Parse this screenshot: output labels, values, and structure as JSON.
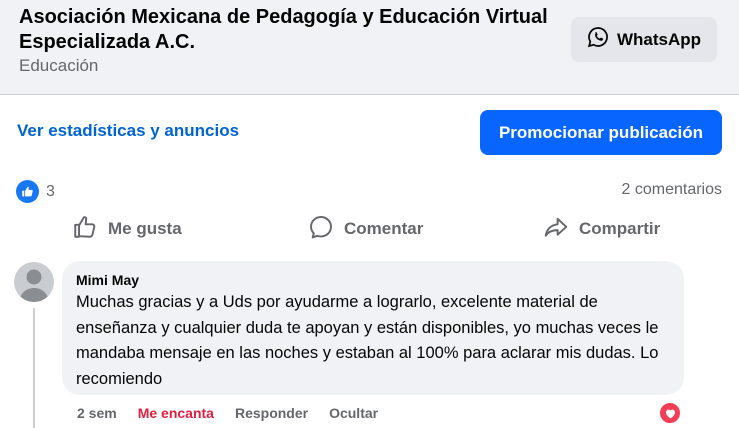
{
  "header": {
    "page_name": "Asociación Mexicana de Pedagogía y Educación Virtual Especializada A.C.",
    "category": "Educación",
    "whatsapp_label": "WhatsApp"
  },
  "promo": {
    "stats_link": "Ver estadísticas y anuncios",
    "promote_button": "Promocionar publicación"
  },
  "post_stats": {
    "like_count": "3",
    "comments_label": "2 comentarios"
  },
  "actions": {
    "like": "Me gusta",
    "comment": "Comentar",
    "share": "Compartir"
  },
  "comment": {
    "author": "Mimi May",
    "text": "Muchas gracias y a Uds por ayudarme a lograrlo, excelente material de enseñanza y cualquier duda te apoyan y están disponibles, yo muchas veces le mandaba mensaje en las noches y estaban al 100% para aclarar mis dudas. Lo recomiendo",
    "time": "2 sem",
    "reaction_label": "Me encanta",
    "reply_label": "Responder",
    "hide_label": "Ocultar"
  },
  "colors": {
    "primary": "#0866ff",
    "link": "#0064d1",
    "love": "#e41e3f",
    "bubble": "#f0f2f5"
  },
  "icons": [
    "whatsapp-icon",
    "like-badge-icon",
    "thumbs-up-icon",
    "comment-icon",
    "share-icon",
    "heart-icon"
  ]
}
